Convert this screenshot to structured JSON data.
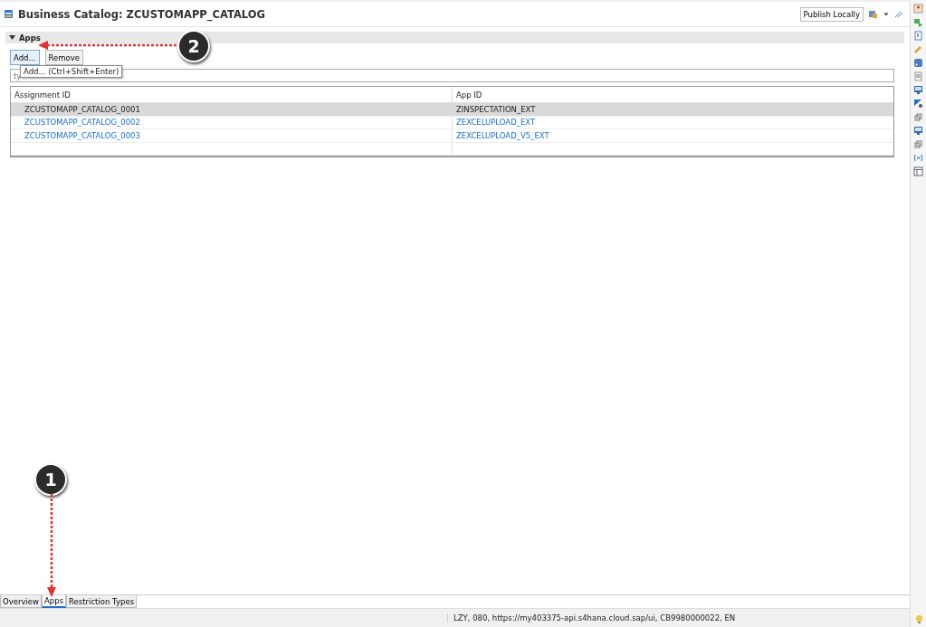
{
  "editor": {
    "title": "Business Catalog: ZCUSTOMAPP_CATALOG",
    "publish_button": "Publish Locally"
  },
  "section": {
    "title": "Apps",
    "expanded": true,
    "buttons": [
      "Add...",
      "Remove"
    ],
    "tooltip": "Add... (Ctrl+Shift+Enter)",
    "filter": {
      "placeholder": "ty"
    },
    "table": {
      "columns": [
        "Assignment ID",
        "App ID"
      ],
      "rows": [
        {
          "assignment_id": "ZCUSTOMAPP_CATALOG_0001",
          "app_id": "ZINSPECTATION_EXT",
          "selected": true
        },
        {
          "assignment_id": "ZCUSTOMAPP_CATALOG_0002",
          "app_id": "ZEXCELUPLOAD_EXT",
          "selected": false
        },
        {
          "assignment_id": "ZCUSTOMAPP_CATALOG_0003",
          "app_id": "ZEXCELUPLOAD_V5_EXT",
          "selected": false
        }
      ]
    }
  },
  "bottom_tabs": [
    {
      "label": "Overview",
      "selected": false
    },
    {
      "label": "Apps",
      "selected": true
    },
    {
      "label": "Restriction Types",
      "selected": false
    }
  ],
  "status_bar": "LZY, 080, https://my403375-api.s4hana.cloud.sap/ui, CB9980000022, EN",
  "annotations": [
    {
      "label": "1"
    },
    {
      "label": "2"
    }
  ]
}
